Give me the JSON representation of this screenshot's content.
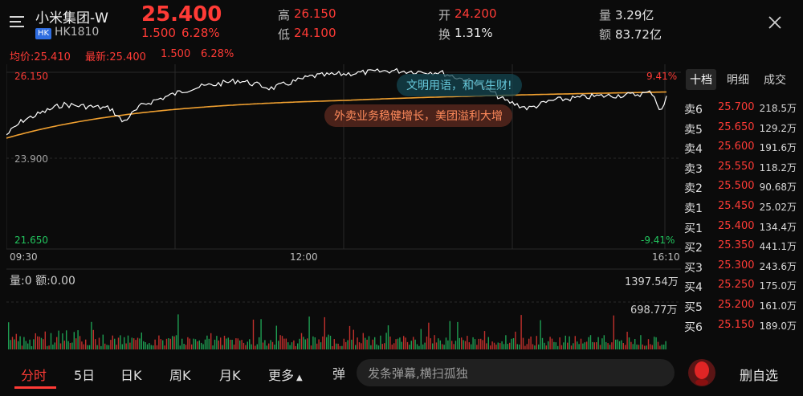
{
  "header": {
    "stock_name": "小米集团-W",
    "market_badge": "HK",
    "stock_code": "HK1810",
    "price": "25.400",
    "change": "1.500",
    "change_pct": "6.28%",
    "high_label": "高",
    "high_value": "26.150",
    "low_label": "低",
    "low_value": "24.100",
    "open_label": "开",
    "open_value": "24.200",
    "turnover_label": "换",
    "turnover_value": "1.31%",
    "volume_label": "量",
    "volume_value": "3.29亿",
    "amount_label": "额",
    "amount_value": "83.72亿"
  },
  "info_row": {
    "avg_label": "均价:25.410",
    "latest_label": "最新:25.400",
    "change": "1.500",
    "change_pct": "6.28%"
  },
  "axis": {
    "y_top": "26.150",
    "y_mid": "23.900",
    "y_bottom": "21.650",
    "pct_top": "9.41%",
    "pct_bottom": "-9.41%",
    "x_start": "09:30",
    "x_mid": "12:00",
    "x_end": "16:10"
  },
  "danmaku": [
    "文明用语，和气生财!",
    "外卖业务稳健增长，美团溢利大增"
  ],
  "volume_area": {
    "vol_info": "量:0 额:0.00",
    "max_label": "1397.54万",
    "mid_label": "698.77万"
  },
  "order_book": {
    "tabs": [
      "十档",
      "明细",
      "成交"
    ],
    "rows": [
      {
        "label": "卖6",
        "price": "25.700",
        "vol": "218.5万"
      },
      {
        "label": "卖5",
        "price": "25.650",
        "vol": "129.2万"
      },
      {
        "label": "卖4",
        "price": "25.600",
        "vol": "191.6万"
      },
      {
        "label": "卖3",
        "price": "25.550",
        "vol": "118.2万"
      },
      {
        "label": "卖2",
        "price": "25.500",
        "vol": "90.68万"
      },
      {
        "label": "卖1",
        "price": "25.450",
        "vol": "25.02万"
      },
      {
        "label": "买1",
        "price": "25.400",
        "vol": "134.4万"
      },
      {
        "label": "买2",
        "price": "25.350",
        "vol": "441.1万"
      },
      {
        "label": "买3",
        "price": "25.300",
        "vol": "243.6万"
      },
      {
        "label": "买4",
        "price": "25.250",
        "vol": "175.0万"
      },
      {
        "label": "买5",
        "price": "25.200",
        "vol": "161.0万"
      },
      {
        "label": "买6",
        "price": "25.150",
        "vol": "189.0万"
      }
    ]
  },
  "bottom_bar": {
    "tabs": [
      "分时",
      "5日",
      "日K",
      "周K",
      "月K",
      "更多"
    ],
    "danmu_icon": "弹",
    "danmu_placeholder": "发条弹幕,横扫孤独",
    "delete_label": "删自选"
  },
  "colors": {
    "up": "#ff3b36",
    "down": "#22c55e",
    "avg_line": "#f0a030",
    "price_line": "#ffffff"
  }
}
